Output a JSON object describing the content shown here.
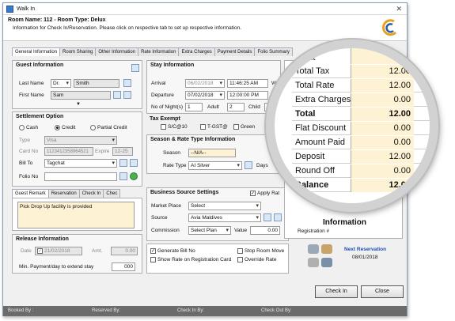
{
  "window": {
    "title": "Walk In"
  },
  "header": {
    "line1": "Room Name: 112 - Room Type: Delux",
    "line2": "Information for Check In/Reservation. Please click on respective tab to set up respective information."
  },
  "tabs": [
    "General Information",
    "Room Sharing",
    "Other Information",
    "Rate Information",
    "Extra Charges",
    "Payment Details",
    "Folio Summary"
  ],
  "guest": {
    "title": "Guest Information",
    "last_name_label": "Last Name",
    "salutation": "Dr.",
    "last_name": "Smith",
    "first_name_label": "First Name",
    "first_name": "Sam"
  },
  "settlement": {
    "title": "Settlement Option",
    "cash": "Cash",
    "credit": "Credit",
    "partial": "Partial Credit",
    "type_label": "Type",
    "type_value": "Visa",
    "card_label": "Card No",
    "card_value": "1123412358964521",
    "expire_label": "Expire",
    "expire_value": "12-25",
    "billto_label": "Bill To",
    "billto_value": "Tagchat",
    "folio_label": "Folio No"
  },
  "remark_tabs": [
    "Guest Remark",
    "Reservation",
    "Check In",
    "Chec"
  ],
  "remark_text": "Pick Drop Up facility is provided",
  "release": {
    "title": "Release Information",
    "date_label": "Date",
    "date_value": "21/02/2018",
    "amt_label": "Amt.",
    "amt_value": "0.00",
    "min_label": "Min. Payment/day to extend stay",
    "min_value": "000"
  },
  "stay": {
    "title": "Stay Information",
    "arrival_label": "Arrival",
    "arrival_date": "06/02/2018",
    "arrival_time": "11:46:25 AM",
    "arrival_day": "Wednes",
    "departure_label": "Departure",
    "departure_date": "07/02/2018",
    "departure_time": "12:00:00 PM",
    "departure_day": "Th",
    "nights_label": "No of Night(s)",
    "nights": "1",
    "adult_label": "Adult",
    "adult": "2",
    "child_label": "Child",
    "child": "0"
  },
  "tax": {
    "title": "Tax Exempt",
    "s1": "S/C@10",
    "s2": "T-GST@",
    "s3": "Green"
  },
  "season": {
    "title": "Season & Rate Type Information",
    "season_label": "Season",
    "season_value": "--N/A--",
    "rate_label": "Rate Type",
    "rate_value": "AI Silver",
    "days_label": "Days"
  },
  "business": {
    "title": "Business Source Settings",
    "apply": "Apply Rat",
    "market_label": "Market Place",
    "market_value": "Select",
    "source_label": "Source",
    "source_value": "Avia Maldives",
    "commission_label": "Commission",
    "commission_value": "Select Plan",
    "value_label": "Value",
    "value": "0.00"
  },
  "options": {
    "generate_bill": "Generate Bill No",
    "show_rate": "Show Rate on Registration Card",
    "stop_room": "Stop Room Move",
    "override_rate": "Override Rate"
  },
  "next_res": {
    "label": "Next Reservation",
    "date": "08/01/2018"
  },
  "buttons": {
    "check_in": "Check In",
    "close": "Close"
  },
  "footer": {
    "booked_by": "Booked By :",
    "reserved_by": "Reserved By:",
    "checkin_by": "Check In By:",
    "checkout_by": "Check Out By:"
  },
  "right_partial": {
    "information": "Information",
    "registration": "Registration #"
  },
  "magnifier": {
    "top_partial": "ount",
    "rows": [
      {
        "label": "Total Tax",
        "value": "12.00"
      },
      {
        "label": "Total Rate",
        "value": "12.00"
      },
      {
        "label": "Extra Charges",
        "value": "0.00"
      },
      {
        "label": "Total",
        "value": "12.00",
        "bold": true
      },
      {
        "label": "Flat Discount",
        "value": "0.00"
      },
      {
        "label": "Amount Paid",
        "value": "0.00"
      },
      {
        "label": "Deposit",
        "value": "12.00"
      },
      {
        "label": "Round Off",
        "value": "0.00"
      },
      {
        "label": "Balance",
        "value": "12.00",
        "bold": true
      }
    ]
  }
}
